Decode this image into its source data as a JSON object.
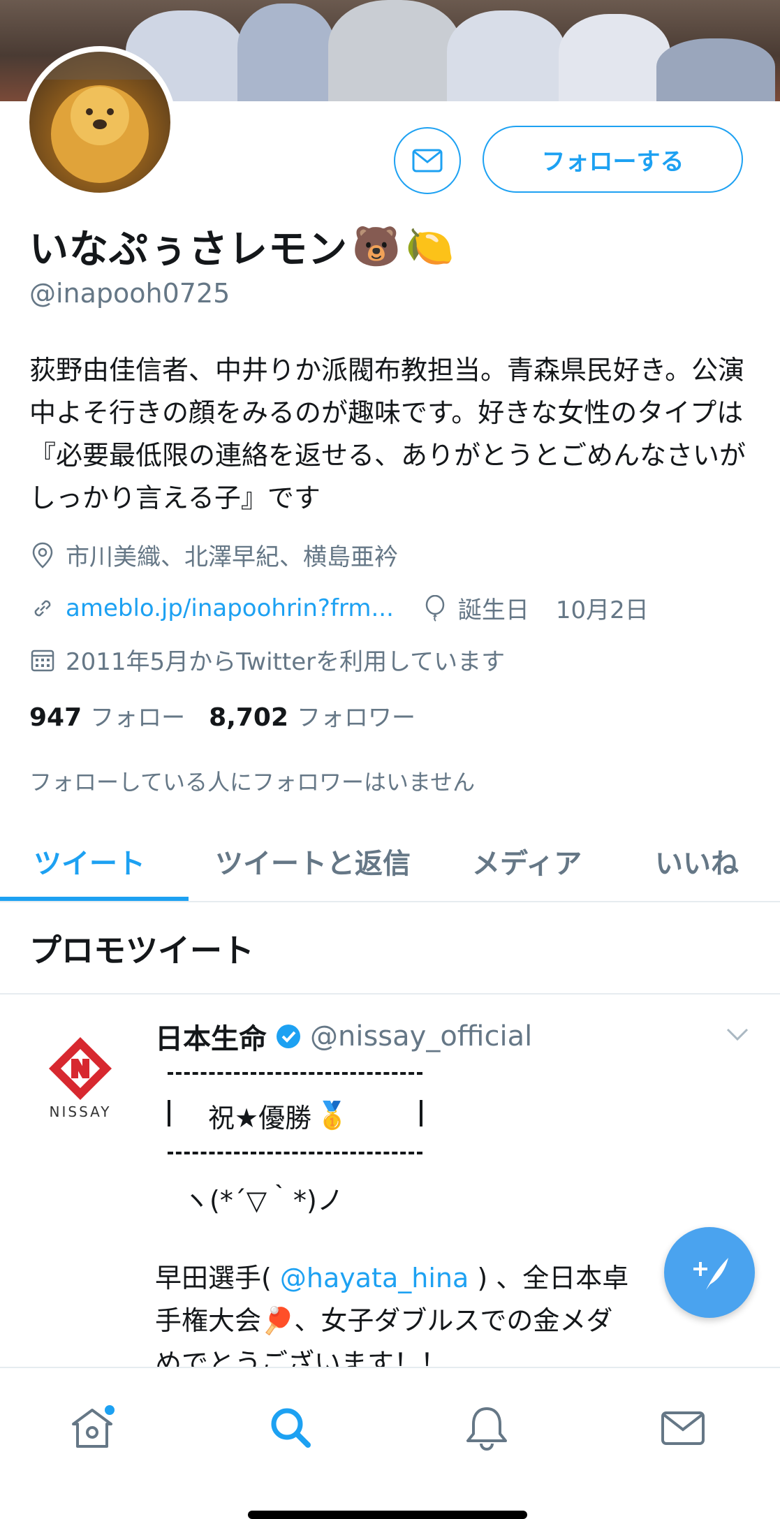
{
  "profile": {
    "display_name": "いなぷぅさレモン",
    "name_emoji_1": "🐻",
    "name_emoji_2": "🍋",
    "handle": "@inapooh0725",
    "bio": "荻野由佳信者、中井りか派閥布教担当。青森県民好き。公演中よそ行きの顔をみるのが趣味です。好きな女性のタイプは『必要最低限の連絡を返せる、ありがとうとごめんなさいがしっかり言える子』です",
    "location": "市川美織、北澤早紀、横島亜衿",
    "url": "ameblo.jp/inapoohrin?frm...",
    "birthday_label": "誕生日",
    "birthday": "10月2日",
    "joined": "2011年5月からTwitterを利用しています",
    "following_count": "947",
    "following_label": "フォロー",
    "followers_count": "8,702",
    "followers_label": "フォロワー",
    "followers_you_know": "フォローしている人にフォロワーはいません"
  },
  "actions": {
    "follow_label": "フォローする"
  },
  "tabs": [
    {
      "label": "ツイート",
      "active": true
    },
    {
      "label": "ツイートと返信",
      "active": false
    },
    {
      "label": "メディア",
      "active": false
    },
    {
      "label": "いいね",
      "active": false
    }
  ],
  "section": {
    "title": "プロモツイート"
  },
  "tweet": {
    "author_name": "日本生命",
    "author_handle": "@nissay_official",
    "avatar_text": "NISSAY",
    "box_text": "祝★優勝",
    "box_emoji": "🥇",
    "kaomoji": "ヽ(*´▽｀*)ノ",
    "line1_prefix": "早田選手( ",
    "mention": "@hayata_hina",
    "line1_suffix": " ) 、全日本卓",
    "line2": "手権大会🏓、女子ダブルスでの金メダ",
    "line3": "めでとうございます！！"
  },
  "colors": {
    "accent": "#1da1f2",
    "secondary_text": "#657786",
    "fab": "#4aa3ef",
    "nissay_red": "#d7282f"
  },
  "icons": [
    "mail-icon",
    "location-pin-icon",
    "link-icon",
    "balloon-icon",
    "calendar-icon",
    "verified-badge-icon",
    "chevron-down-icon",
    "compose-tweet-icon",
    "home-icon",
    "search-icon",
    "notifications-bell-icon",
    "messages-mail-icon"
  ]
}
